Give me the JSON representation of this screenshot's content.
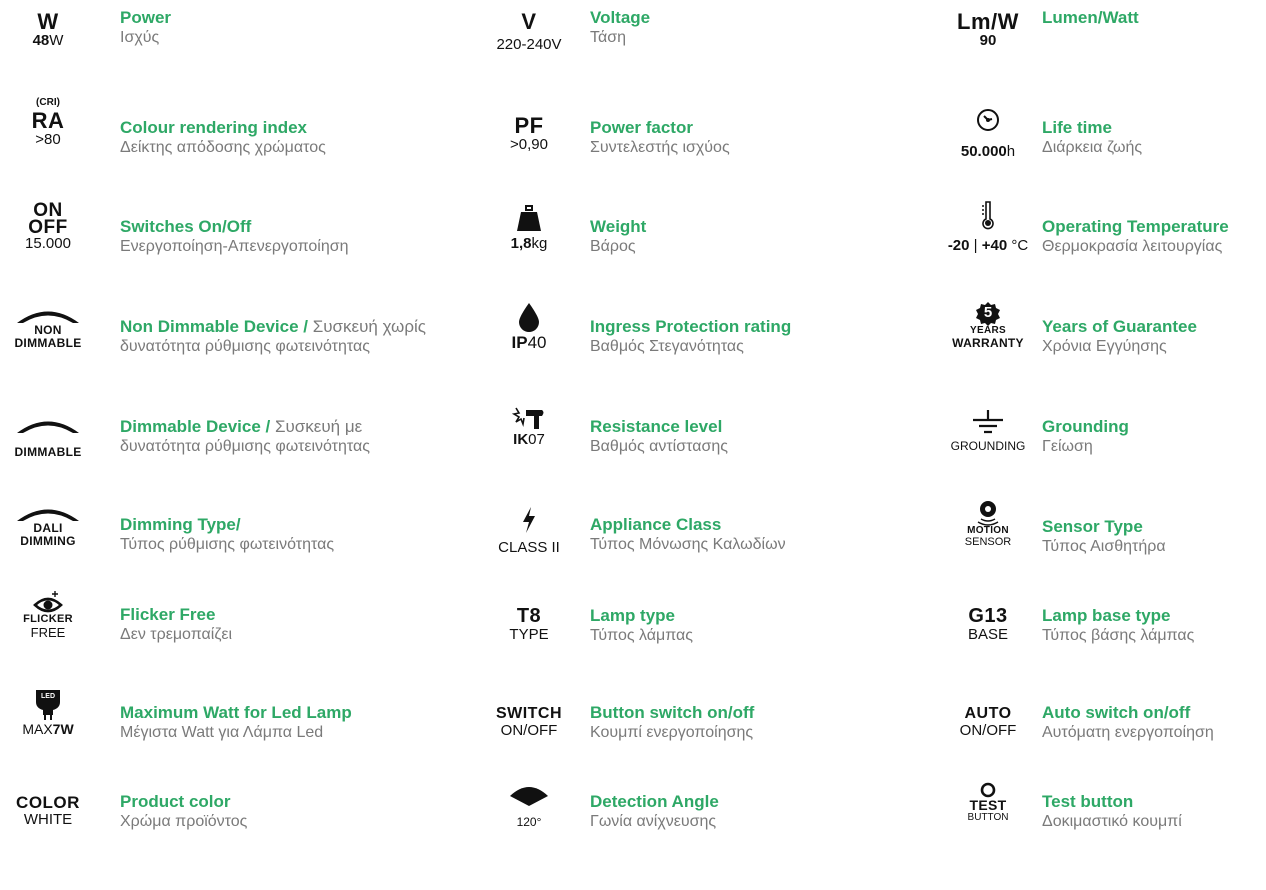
{
  "col1": [
    {
      "icon": {
        "main": "W",
        "val_b": "48",
        "val": "W"
      },
      "title": "Power",
      "sub": "Ισχύς"
    },
    {
      "icon": {
        "top": "(CRI)",
        "main": "RA",
        "val": ">80"
      },
      "title": "Colour rendering index",
      "sub": "Δείκτης απόδοσης χρώματος"
    },
    {
      "icon": {
        "main1": "ON",
        "main2": "OFF",
        "val": "15.000"
      },
      "title": "Switches On/Off",
      "sub": "Ενεργοποίηση-Απενεργοποίηση"
    },
    {
      "icon": {
        "l1": "NON",
        "l2": "DIMMABLE"
      },
      "title": "Non Dimmable Device /",
      "title_inline": " Συσκευή χωρίς",
      "sub": "δυνατότητα ρύθμισης φωτεινότητας"
    },
    {
      "icon": {
        "l1": "DIMMABLE"
      },
      "title": "Dimmable Device /",
      "title_inline": " Συσκευή με",
      "sub": "δυνατότητα ρύθμισης φωτεινότητας"
    },
    {
      "icon": {
        "l1": "DALI",
        "l2": "DIMMING"
      },
      "title": "Dimming Type/",
      "sub": "Τύπος ρύθμισης φωτεινότητας"
    },
    {
      "icon": {
        "l1": "FLICKER",
        "l2": "FREE"
      },
      "title": "Flicker Free",
      "sub": "Δεν τρεμοπαίζει"
    },
    {
      "icon": {
        "badge": "LED",
        "val": "MAX",
        "val_b": "7W"
      },
      "title": "Maximum Watt for Led Lamp",
      "sub": "Μέγιστα Watt για Λάμπα Led"
    },
    {
      "icon": {
        "main": "COLOR",
        "val": "WHITE"
      },
      "title": "Product color",
      "sub": "Χρώμα προϊόντος"
    }
  ],
  "col2": [
    {
      "icon": {
        "main": "V",
        "val": "220-240V"
      },
      "title": "Voltage",
      "sub": "Τάση"
    },
    {
      "icon": {
        "main": "PF",
        "val": ">0,90"
      },
      "title": "Power factor",
      "sub": "Συντελεστής ισχύος"
    },
    {
      "icon": {
        "val_b": "1,8",
        "val": "kg"
      },
      "title": "Weight",
      "sub": "Βάρος"
    },
    {
      "icon": {
        "val_b": "IP",
        "val": "40"
      },
      "title": "Ingress Protection rating",
      "sub": "Βαθμός Στεγανότητας"
    },
    {
      "icon": {
        "val_b": "IK",
        "val": "07"
      },
      "title": "Resistance level",
      "sub": "Βαθμός αντίστασης"
    },
    {
      "icon": {
        "val": "CLASS II"
      },
      "title": "Appliance Class",
      "sub": "Τύπος Μόνωσης Καλωδίων"
    },
    {
      "icon": {
        "main": "T8",
        "val": "TYPE"
      },
      "title": "Lamp type",
      "sub": "Τύπος λάμπας"
    },
    {
      "icon": {
        "main": "SWITCH",
        "val": "ON/OFF"
      },
      "title": "Button switch on/off",
      "sub": "Κουμπί ενεργοποίησης"
    },
    {
      "icon": {
        "val": "120°"
      },
      "title": "Detection Angle",
      "sub": "Γωνία ανίχνευσης"
    }
  ],
  "col3": [
    {
      "icon": {
        "main": "Lm/W",
        "val_b": "90"
      },
      "title": "Lumen/Watt",
      "sub": ""
    },
    {
      "icon": {
        "val_b": "50.000",
        "val": "h"
      },
      "title": "Life time",
      "sub": "Διάρκεια ζωής"
    },
    {
      "icon": {
        "val_b1": "-20",
        "sep": " | ",
        "val_b2": "+40",
        "val": " °C"
      },
      "title": "Operating Temperature",
      "sub": "Θερμοκρασία λειτουργίας"
    },
    {
      "icon": {
        "num": "5",
        "l1": "YEARS",
        "l2": "WARRANTY"
      },
      "title": "Years of Guarantee",
      "sub": "Χρόνια Εγγύησης"
    },
    {
      "icon": {
        "val": "GROUNDING"
      },
      "title": "Grounding",
      "sub": "Γείωση"
    },
    {
      "icon": {
        "l1": "MOTION",
        "l2": "SENSOR"
      },
      "title": "Sensor Type",
      "sub": "Τύπος Αισθητήρα"
    },
    {
      "icon": {
        "main": "G13",
        "val": "BASE"
      },
      "title": "Lamp base type",
      "sub": "Τύπος βάσης λάμπας"
    },
    {
      "icon": {
        "main": "AUTO",
        "val": "ON/OFF"
      },
      "title": "Auto switch on/off",
      "sub": "Αυτόματη ενεργοποίηση"
    },
    {
      "icon": {
        "main": "TEST",
        "val": "BUTTON"
      },
      "title": "Test button",
      "sub": "Δοκιμαστικό κουμπί"
    }
  ],
  "colors": {
    "accent": "#2ea866",
    "text": "#7a7a7a",
    "icon": "#111111"
  }
}
